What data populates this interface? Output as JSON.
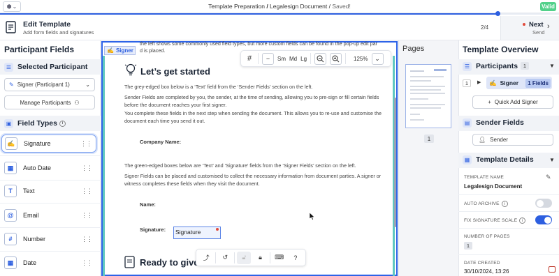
{
  "topbar": {
    "breadcrumb_a": "Template Preparation",
    "sep1": " / ",
    "breadcrumb_b": "Legalesign Document",
    "sep2": " / ",
    "status": "Saved!",
    "valid_badge": "Valid",
    "progress_percent": 89
  },
  "header": {
    "title": "Edit Template",
    "subtitle": "Add form fields and signatures",
    "step": "2/4",
    "next_label": "Next",
    "next_sub": "Send"
  },
  "left_panel": {
    "title": "Participant Fields",
    "selected_participant_heading": "Selected Participant",
    "participant_select_value": "Signer (Participant 1)",
    "manage_button": "Manage Participants",
    "field_types_heading": "Field Types",
    "field_types": [
      {
        "label": "Signature",
        "icon": "signature-icon",
        "glyph": "✍"
      },
      {
        "label": "Auto Date",
        "icon": "calendar-auto-icon",
        "glyph": "▦"
      },
      {
        "label": "Text",
        "icon": "text-icon",
        "glyph": "T"
      },
      {
        "label": "Email",
        "icon": "at-icon",
        "glyph": "@"
      },
      {
        "label": "Number",
        "icon": "hash-icon",
        "glyph": "#"
      },
      {
        "label": "Date",
        "icon": "calendar-icon",
        "glyph": "▦"
      }
    ]
  },
  "document": {
    "signer_tag": "Signer",
    "top_text": "the left shows some commonly used field types, but more custom fields can be found in the pop-up edit panel after",
    "top_text2": "d is placed.",
    "heading1": "Let’s get started",
    "p1": "The grey-edged box below is a ‘Text’ field from the ‘Sender Fields’ section on the left.",
    "p2": "Sender Fields are completed by you, the sender, at the time of sending, allowing you to pre-sign or fill certain fields before the document reaches your first signer.",
    "p3": "You complete these fields in the next step when sending the document. This allows you to re-use and customise the document each time you send it out.",
    "company_label": "Company Name:",
    "p4": "The green-edged boxes below are ‘Text’ and ‘Signature’ fields from the ‘Signer Fields’ section on the left.",
    "p5": "Signer Fields can be placed and customised to collect the necessary information from document parties. A signer or witness completes these fields when they visit the document.",
    "name_label": "Name:",
    "signature_label": "Signature:",
    "signature_field": "Signature",
    "heading2": "Ready to give"
  },
  "toolbar": {
    "grid": "#",
    "minus": "−",
    "sizes": [
      "Sm",
      "Md",
      "Lg"
    ],
    "zoom": "125%"
  },
  "pages_panel": {
    "title": "Pages",
    "page_number": "1"
  },
  "right_panel": {
    "title": "Template Overview",
    "participants_heading": "Participants",
    "participants_count": "1",
    "participant_index": "1",
    "participant_name": "Signer",
    "participant_fields": "1 Fields",
    "quick_add": "Quick Add Signer",
    "sender_fields_heading": "Sender Fields",
    "sender_label": "Sender",
    "template_details_heading": "Template Details",
    "template_name_label": "TEMPLATE NAME",
    "template_name_value": "Legalesign Document",
    "auto_archive_label": "AUTO ARCHIVE",
    "auto_archive_on": false,
    "fix_sig_label": "FIX SIGNATURE SCALE",
    "fix_sig_on": true,
    "pages_label": "NUMBER OF PAGES",
    "pages_value": "1",
    "date_created_label": "DATE CREATED",
    "date_created_value": "30/10/2024, 13:26"
  },
  "colors": {
    "accent": "#2d5fe0",
    "valid": "#53d18b",
    "signer_edge": "#5fc8c0"
  }
}
